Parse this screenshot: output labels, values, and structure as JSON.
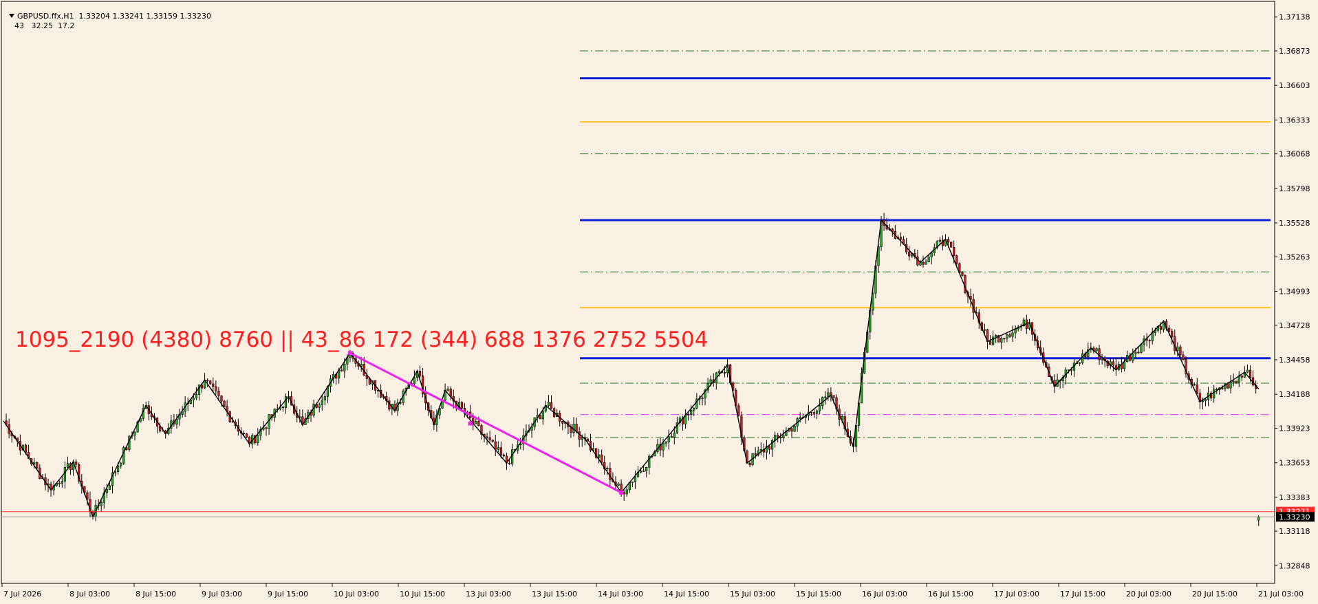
{
  "header": {
    "symbol_info": "GBPUSD.ffx,H1  1.33204 1.33241 1.33159 1.33230",
    "indicator_info": "43   32.25  17.2"
  },
  "overlay_text": "1095_2190 (4380) 8760 || 43_86 172 (344) 688 1376 2752 5504",
  "colors": {
    "background": "#faefe3",
    "bull_candle": "#22b322",
    "bear_candle": "#d81b1b",
    "zigzag": "#000000",
    "trendline": "#ee22ee",
    "level_blue": "#0a1fd8",
    "level_gold": "#ffc21a",
    "level_green": "#1f7a1f",
    "level_magenta": "#e63ce6",
    "price_line_red": "#ff2a2a",
    "price_label_bg": "#000000"
  },
  "chart_data": {
    "type": "candlestick",
    "symbol": "GBPUSD.ffx",
    "timeframe": "H1",
    "ohlc_last": {
      "open": 1.33204,
      "high": 1.33241,
      "low": 1.33159,
      "close": 1.3323
    },
    "ylim": [
      1.3271,
      1.3726
    ],
    "y_ticks": [
      "1.37138",
      "1.36873",
      "1.36603",
      "1.36333",
      "1.36068",
      "1.35798",
      "1.35528",
      "1.35263",
      "1.34993",
      "1.34728",
      "1.34458",
      "1.34188",
      "1.33923",
      "1.33653",
      "1.33383",
      "1.33118",
      "1.32848"
    ],
    "x_ticks": [
      "7 Jul 2026",
      "8 Jul 03:00",
      "8 Jul 15:00",
      "9 Jul 03:00",
      "9 Jul 15:00",
      "10 Jul 03:00",
      "10 Jul 15:00",
      "13 Jul 03:00",
      "13 Jul 15:00",
      "14 Jul 03:00",
      "14 Jul 15:00",
      "15 Jul 03:00",
      "15 Jul 15:00",
      "16 Jul 03:00",
      "16 Jul 15:00",
      "17 Jul 03:00",
      "17 Jul 15:00",
      "20 Jul 03:00",
      "20 Jul 15:00",
      "21 Jul 03:00"
    ],
    "current_price": "1.33230",
    "bid_line_label": "1.33271",
    "horizontal_levels": [
      {
        "price": 1.36873,
        "style": "dashdot",
        "color": "green"
      },
      {
        "price": 1.36659,
        "style": "solid",
        "color": "blue"
      },
      {
        "price": 1.36318,
        "style": "solid",
        "color": "gold"
      },
      {
        "price": 1.36068,
        "style": "dashdot",
        "color": "green"
      },
      {
        "price": 1.3555,
        "style": "solid",
        "color": "blue"
      },
      {
        "price": 1.35145,
        "style": "dashdot",
        "color": "green"
      },
      {
        "price": 1.34865,
        "style": "solid",
        "color": "gold"
      },
      {
        "price": 1.3447,
        "style": "solid",
        "color": "blue"
      },
      {
        "price": 1.34275,
        "style": "dashdot",
        "color": "green"
      },
      {
        "price": 1.3403,
        "style": "dashdot",
        "color": "magenta"
      },
      {
        "price": 1.3385,
        "style": "dashdot",
        "color": "green"
      }
    ],
    "zigzag": [
      [
        0,
        1.3398
      ],
      [
        17,
        1.3344
      ],
      [
        25,
        1.3366
      ],
      [
        32,
        1.3323
      ],
      [
        51,
        1.341
      ],
      [
        58,
        1.3388
      ],
      [
        72,
        1.343
      ],
      [
        88,
        1.338
      ],
      [
        102,
        1.3417
      ],
      [
        107,
        1.3395
      ],
      [
        124,
        1.3451
      ],
      [
        140,
        1.3406
      ],
      [
        148,
        1.3437
      ],
      [
        154,
        1.3395
      ],
      [
        158,
        1.3422
      ],
      [
        180,
        1.3365
      ],
      [
        194,
        1.341
      ],
      [
        208,
        1.3384
      ],
      [
        221,
        1.3342
      ],
      [
        259,
        1.3442
      ],
      [
        266,
        1.3365
      ],
      [
        296,
        1.3418
      ],
      [
        304,
        1.3378
      ],
      [
        314,
        1.3555
      ],
      [
        328,
        1.3522
      ],
      [
        337,
        1.354
      ],
      [
        352,
        1.346
      ],
      [
        367,
        1.3475
      ],
      [
        376,
        1.3425
      ],
      [
        389,
        1.3455
      ],
      [
        398,
        1.3438
      ],
      [
        415,
        1.3476
      ],
      [
        428,
        1.3413
      ],
      [
        444,
        1.3436
      ],
      [
        449,
        1.3423
      ]
    ],
    "trendline": {
      "from": [
        124,
        1.3451
      ],
      "mid": [
        167,
        1.3396
      ],
      "to": [
        221,
        1.3342
      ]
    }
  }
}
